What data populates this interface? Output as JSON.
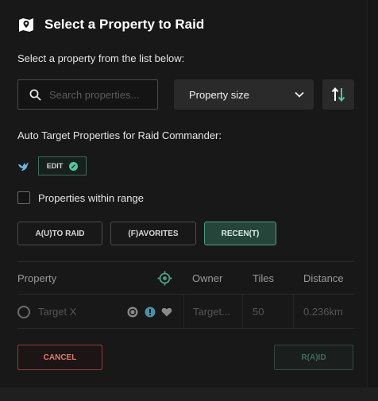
{
  "header": {
    "title": "Select a Property to Raid"
  },
  "subtitle": "Select a property from the list below:",
  "search": {
    "placeholder": "Search properties..."
  },
  "sort_select": {
    "value": "Property size"
  },
  "auto_target": {
    "label": "Auto Target Properties for Raid Commander:",
    "edit_label": "EDIT"
  },
  "range_filter": {
    "label": "Properties within range",
    "checked": false
  },
  "tabs": [
    {
      "label": "A(U)TO RAID",
      "active": false
    },
    {
      "label": "(F)AVORITES",
      "active": false
    },
    {
      "label": "RECEN(T)",
      "active": true
    }
  ],
  "table": {
    "columns": [
      "Property",
      "Owner",
      "Tiles",
      "Distance"
    ],
    "rows": [
      {
        "name": "Target X",
        "owner": "Target...",
        "tiles": "50",
        "distance": "0.236km"
      }
    ]
  },
  "actions": {
    "cancel": "CANCEL",
    "raid": "R(A)ID"
  },
  "colors": {
    "accent": "#4f9c80",
    "danger": "#e07a6e",
    "background": "#181818"
  }
}
